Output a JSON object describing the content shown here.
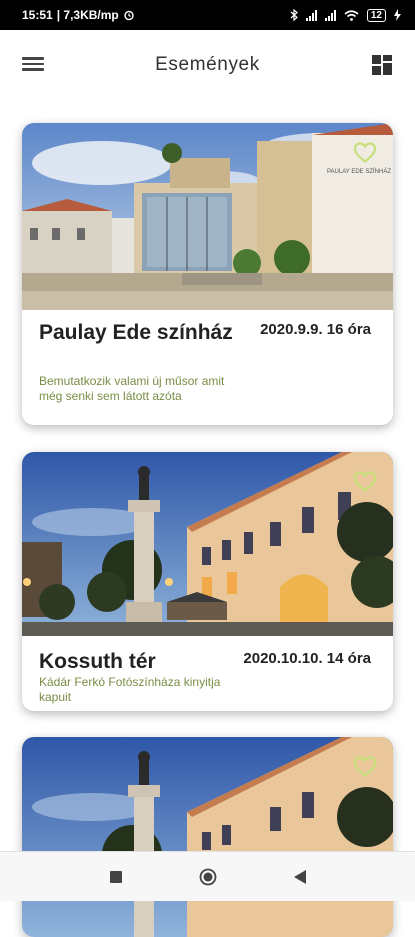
{
  "status_bar": {
    "time": "15:51",
    "speed": "| 7,3KB/mp",
    "battery": "12"
  },
  "app_bar": {
    "title": "Események",
    "menu_icon": "hamburger-menu-icon",
    "layout_icon": "grid-layout-icon"
  },
  "colors": {
    "accent": "#7a8d45",
    "heart": "#c7e07a"
  },
  "events": [
    {
      "name": "Paulay Ede színház",
      "date": "2020.9.9. 16 óra",
      "description": "Bemutatkozik valami új műsor amit még senki sem látott azóta",
      "image_label": "PAULAY EDE SZÍNHÁZ"
    },
    {
      "name": "Kossuth tér",
      "date": "2020.10.10. 14 óra",
      "description": "Kádár Ferkó Fotószínháza kinyitja kapuit"
    }
  ],
  "nav_bar": [
    "square-recents-icon",
    "circle-home-icon",
    "triangle-back-icon"
  ]
}
